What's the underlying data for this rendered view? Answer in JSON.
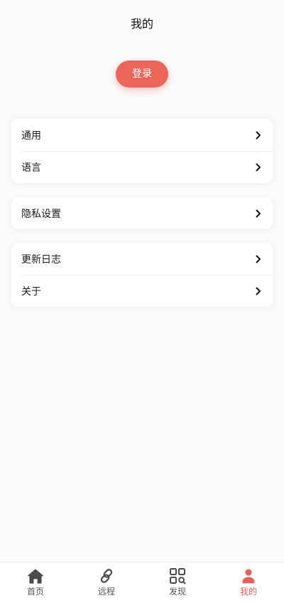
{
  "header": {
    "title": "我的"
  },
  "login": {
    "label": "登录"
  },
  "groups": [
    {
      "items": [
        {
          "label": "通用"
        },
        {
          "label": "语言"
        }
      ]
    },
    {
      "items": [
        {
          "label": "隐私设置"
        }
      ]
    },
    {
      "items": [
        {
          "label": "更新日志"
        },
        {
          "label": "关于"
        }
      ]
    }
  ],
  "tabbar": {
    "items": [
      {
        "label": "首页",
        "icon": "home-icon"
      },
      {
        "label": "远程",
        "icon": "link-icon"
      },
      {
        "label": "发现",
        "icon": "discover-icon"
      },
      {
        "label": "我的",
        "icon": "user-icon",
        "active": true
      }
    ]
  },
  "colors": {
    "accent": "#ed645b",
    "active_tab": "#e5605a",
    "inactive_tab": "#555555",
    "background": "#fafafa"
  }
}
